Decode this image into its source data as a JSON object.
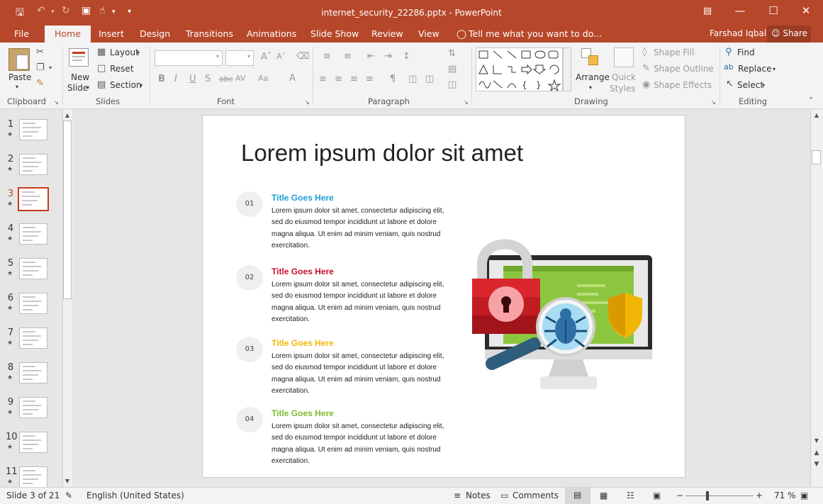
{
  "window": {
    "title": "internet_security_22286.pptx - PowerPoint"
  },
  "tabs": [
    "File",
    "Home",
    "Insert",
    "Design",
    "Transitions",
    "Animations",
    "Slide Show",
    "Review",
    "View"
  ],
  "tell_me": "Tell me what you want to do...",
  "user": "Farshad Iqbal",
  "share": "Share",
  "ribbon": {
    "clipboard": {
      "paste": "Paste",
      "group": "Clipboard"
    },
    "slides": {
      "new_slide_1": "New",
      "new_slide_2": "Slide",
      "layout": "Layout",
      "reset": "Reset",
      "section": "Section",
      "group": "Slides"
    },
    "font": {
      "group": "Font"
    },
    "paragraph": {
      "group": "Paragraph"
    },
    "drawing": {
      "arrange": "Arrange",
      "quick_styles_1": "Quick",
      "quick_styles_2": "Styles",
      "shape_fill": "Shape Fill",
      "shape_outline": "Shape Outline",
      "shape_effects": "Shape Effects",
      "group": "Drawing"
    },
    "editing": {
      "find": "Find",
      "replace": "Replace",
      "select": "Select",
      "group": "Editing"
    }
  },
  "thumbnails": [
    "1",
    "2",
    "3",
    "4",
    "5",
    "6",
    "7",
    "8",
    "9",
    "10",
    "11"
  ],
  "selected_slide": 3,
  "slide": {
    "title": "Lorem ipsum dolor sit amet",
    "items": [
      {
        "num": "01",
        "title": "Title Goes Here",
        "color": "#1a9fd6",
        "body": "Lorem ipsum dolor sit amet, consectetur adipiscing elit, sed do eiusmod tempor incididunt ut labore et dolore magna aliqua. Ut enim ad minim veniam, quis nostrud exercitation."
      },
      {
        "num": "02",
        "title": "Title Goes Here",
        "color": "#c8102e",
        "body": "Lorem ipsum dolor sit amet, consectetur adipiscing elit, sed do eiusmod tempor incididunt ut labore et dolore magna aliqua. Ut enim ad minim veniam, quis nostrud exercitation."
      },
      {
        "num": "03",
        "title": "Title Goes Here",
        "color": "#f2b705",
        "body": "Lorem ipsum dolor sit amet, consectetur adipiscing elit, sed do eiusmod tempor incididunt ut labore et dolore magna aliqua. Ut enim ad minim veniam, quis nostrud exercitation."
      },
      {
        "num": "04",
        "title": "Title Goes Here",
        "color": "#7dbb2e",
        "body": "Lorem ipsum dolor sit amet, consectetur adipiscing elit, sed do eiusmod tempor incididunt ut labore et dolore magna aliqua. Ut enim ad minim veniam, quis nostrud exercitation."
      }
    ]
  },
  "status": {
    "slide": "Slide 3 of 21",
    "language": "English (United States)",
    "notes": "Notes",
    "comments": "Comments",
    "zoom": "71 %"
  },
  "colors": {
    "accent": "#b7472a",
    "lock_red": "#d9262c",
    "screen_green": "#8cc63f",
    "shield_gold": "#f2b705"
  }
}
